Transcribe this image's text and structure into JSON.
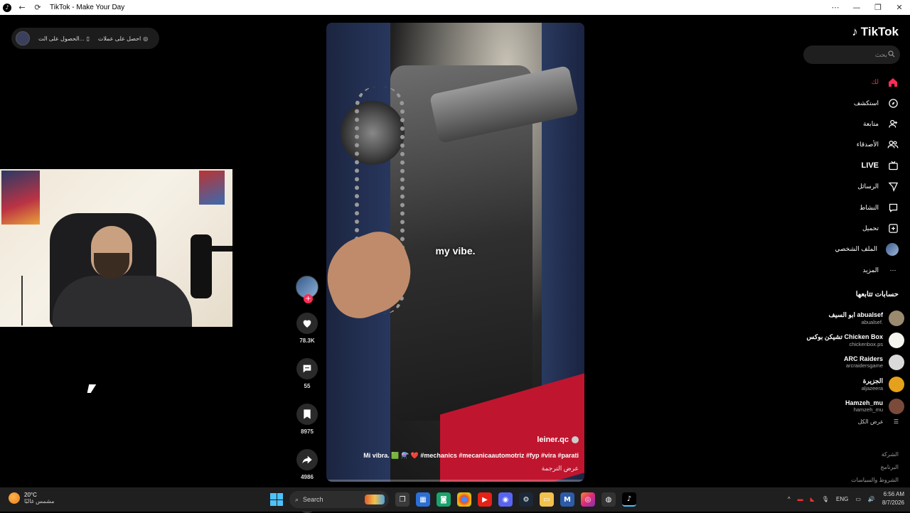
{
  "window": {
    "title": "TikTok - Make Your Day",
    "back_glyph": "←",
    "reload_glyph": "⟳",
    "more_glyph": "⋯",
    "minimize_glyph": "—",
    "restore_glyph": "❐",
    "close_glyph": "✕"
  },
  "coins_bar": {
    "get_coins_label": "احصل على عملات",
    "get_app_label": "الحصول على الت..."
  },
  "video": {
    "overlay_caption": "my vibe.",
    "author": "leiner.qc",
    "description": "Mi vibra. 🟩 ⚗️ ❤️ #mechanics #mecanicaautomotriz #fyp #vira #parati",
    "translate_label": "عرض الترجمة",
    "progress": 0.0
  },
  "actions": {
    "follow_plus": "+",
    "likes": "78.3K",
    "comments": "55",
    "saves": "8975",
    "shares": "4986"
  },
  "sidebar": {
    "brand": "TikTok",
    "search_placeholder": "بحث",
    "nav": [
      {
        "label": "لك",
        "icon": "home-icon"
      },
      {
        "label": "استكشف",
        "icon": "compass-icon"
      },
      {
        "label": "متابعة",
        "icon": "user-follow-icon"
      },
      {
        "label": "الأصدقاء",
        "icon": "friends-icon"
      },
      {
        "label": "LIVE",
        "icon": "live-tv-icon"
      },
      {
        "label": "الرسائل",
        "icon": "send-icon"
      },
      {
        "label": "النشاط",
        "icon": "activity-icon"
      },
      {
        "label": "تحميل",
        "icon": "upload-icon"
      },
      {
        "label": "الملف الشخصي",
        "icon": "profile-avatar"
      },
      {
        "label": "المزيد",
        "icon": "more-icon"
      }
    ],
    "following_title": "حسابات تتابعها",
    "following": [
      {
        "name": "ابو السيف abualsef",
        "username": "abualsef.",
        "color": "#9a8a70"
      },
      {
        "name": "تشيكن بوكس Chicken Box",
        "username": "chickenbox.ps",
        "color": "#f5f5f0"
      },
      {
        "name": "ARC Raiders",
        "username": "arcraidersgame",
        "color": "#d9d9d9"
      },
      {
        "name": "الجزيرة",
        "username": "aljazeera",
        "color": "#e6a11c"
      },
      {
        "name": "Hamzeh_mu",
        "username": "hamzeh_mu",
        "color": "#7a4a3a"
      }
    ],
    "view_all": "عرض الكل",
    "footer": [
      "الشركة",
      "البرنامج",
      "الشروط والسياسات"
    ]
  },
  "taskbar": {
    "temperature": "20°C",
    "weather_desc": "مشمس غالبًا",
    "search_label": "Search",
    "lang": "ENG",
    "time": "6:56 AM",
    "date": "8/7/2026"
  }
}
